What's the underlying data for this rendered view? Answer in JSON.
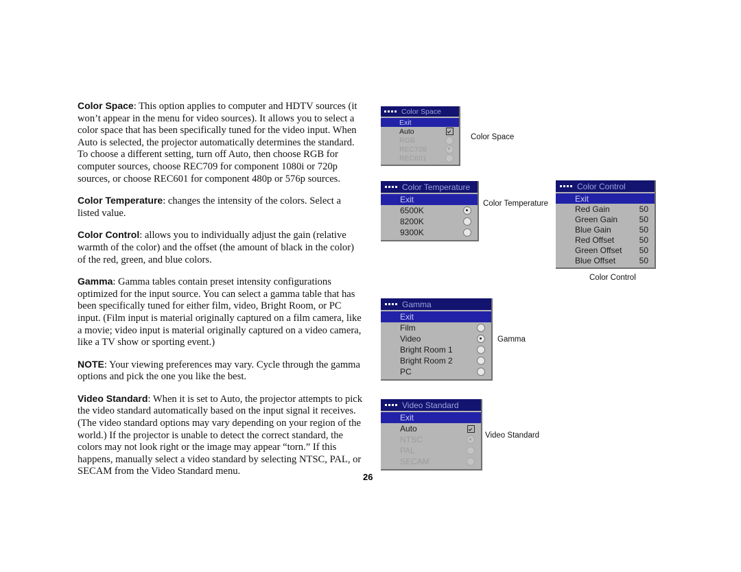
{
  "page": {
    "number": "26"
  },
  "document": {
    "paragraphs": [
      {
        "lead": "Color Space",
        "text": ": This option applies to computer and HDTV sources (it won’t appear in the menu for video sources). It allows you to select a color space that has been specifically tuned for the video input. When Auto is selected, the projector automatically determines the standard. To choose a different setting, turn off Auto, then choose RGB for computer sources, choose REC709 for component 1080i or 720p sources, or choose REC601 for component 480p or 576p sources."
      },
      {
        "lead": "Color Temperature",
        "text": ": changes the intensity of the colors. Select a listed value."
      },
      {
        "lead": "Color Control",
        "text": ": allows you to individually adjust the gain (relative warmth of the color) and the offset (the amount of black in the color) of the red, green, and blue colors."
      },
      {
        "lead": "Gamma",
        "text": ": Gamma tables contain preset intensity configurations optimized for the input source. You can select a gamma table that has been specifically tuned for either film, video, Bright Room, or PC input. (Film input is material originally captured on a film camera, like a movie; video input is material originally captured on a video camera, like a TV show or sporting event.)"
      },
      {
        "lead": "NOTE",
        "text": ": Your viewing preferences may vary. Cycle through the gamma options and pick the one you like the best."
      },
      {
        "lead": "Video Standard",
        "text": ": When it is set to Auto, the projector attempts to pick the video standard automatically based on the input signal it receives. (The video standard options may vary depending on your region of the world.) If the projector is unable to detect the correct standard, the colors may not look right or the image may appear “torn.” If this happens, manually select a video standard by selecting NTSC, PAL, or SECAM from the Video Standard menu."
      }
    ]
  },
  "colors": {
    "menu_title_bar": "#131370",
    "menu_title_text": "#9aa4dd",
    "menu_body": "#b6b6b6",
    "menu_highlight": "#2222a8",
    "menu_highlight_text": "#c9cdf0",
    "menu_text": "#1b1b1b",
    "menu_text_disabled": "#9d9d9d",
    "page_background": "#ffffff"
  },
  "menus": {
    "color_space": {
      "title": "Color Space",
      "caption": "Color Space",
      "rows": [
        {
          "label": "Exit",
          "control": "none",
          "selected": false,
          "disabled": false,
          "exit": true
        },
        {
          "label": "Auto",
          "control": "checkbox",
          "selected": true,
          "disabled": false,
          "exit": false
        },
        {
          "label": "RGB",
          "control": "radio",
          "selected": false,
          "disabled": true,
          "exit": false
        },
        {
          "label": "REC709",
          "control": "radio",
          "selected": true,
          "disabled": true,
          "exit": false
        },
        {
          "label": "REC601",
          "control": "radio",
          "selected": false,
          "disabled": true,
          "exit": false
        }
      ]
    },
    "color_temperature": {
      "title": "Color Temperature",
      "caption": "Color Temperature",
      "rows": [
        {
          "label": "Exit",
          "control": "none",
          "selected": false,
          "disabled": false,
          "exit": true
        },
        {
          "label": "6500K",
          "control": "radio",
          "selected": true,
          "disabled": false,
          "exit": false
        },
        {
          "label": "8200K",
          "control": "radio",
          "selected": false,
          "disabled": false,
          "exit": false
        },
        {
          "label": "9300K",
          "control": "radio",
          "selected": false,
          "disabled": false,
          "exit": false
        }
      ]
    },
    "color_control": {
      "title": "Color Control",
      "caption": "Color Control",
      "rows": [
        {
          "label": "Exit",
          "value": "",
          "control": "none",
          "exit": true
        },
        {
          "label": "Red Gain",
          "value": "50",
          "control": "value",
          "exit": false
        },
        {
          "label": "Green Gain",
          "value": "50",
          "control": "value",
          "exit": false
        },
        {
          "label": "Blue Gain",
          "value": "50",
          "control": "value",
          "exit": false
        },
        {
          "label": "Red Offset",
          "value": "50",
          "control": "value",
          "exit": false
        },
        {
          "label": "Green Offset",
          "value": "50",
          "control": "value",
          "exit": false
        },
        {
          "label": "Blue Offset",
          "value": "50",
          "control": "value",
          "exit": false
        }
      ]
    },
    "gamma": {
      "title": "Gamma",
      "caption": "Gamma",
      "rows": [
        {
          "label": "Exit",
          "control": "none",
          "selected": false,
          "disabled": false,
          "exit": true
        },
        {
          "label": "Film",
          "control": "radio",
          "selected": false,
          "disabled": false,
          "exit": false
        },
        {
          "label": "Video",
          "control": "radio",
          "selected": true,
          "disabled": false,
          "exit": false
        },
        {
          "label": "Bright Room 1",
          "control": "radio",
          "selected": false,
          "disabled": false,
          "exit": false
        },
        {
          "label": "Bright Room 2",
          "control": "radio",
          "selected": false,
          "disabled": false,
          "exit": false
        },
        {
          "label": "PC",
          "control": "radio",
          "selected": false,
          "disabled": false,
          "exit": false
        }
      ]
    },
    "video_standard": {
      "title": "Video Standard",
      "caption": "Video Standard",
      "rows": [
        {
          "label": "Exit",
          "control": "none",
          "selected": false,
          "disabled": false,
          "exit": true
        },
        {
          "label": "Auto",
          "control": "checkbox",
          "selected": true,
          "disabled": false,
          "exit": false
        },
        {
          "label": "NTSC",
          "control": "radio",
          "selected": true,
          "disabled": true,
          "exit": false
        },
        {
          "label": "PAL",
          "control": "radio",
          "selected": false,
          "disabled": true,
          "exit": false
        },
        {
          "label": "SECAM",
          "control": "radio",
          "selected": false,
          "disabled": true,
          "exit": false
        }
      ]
    }
  }
}
